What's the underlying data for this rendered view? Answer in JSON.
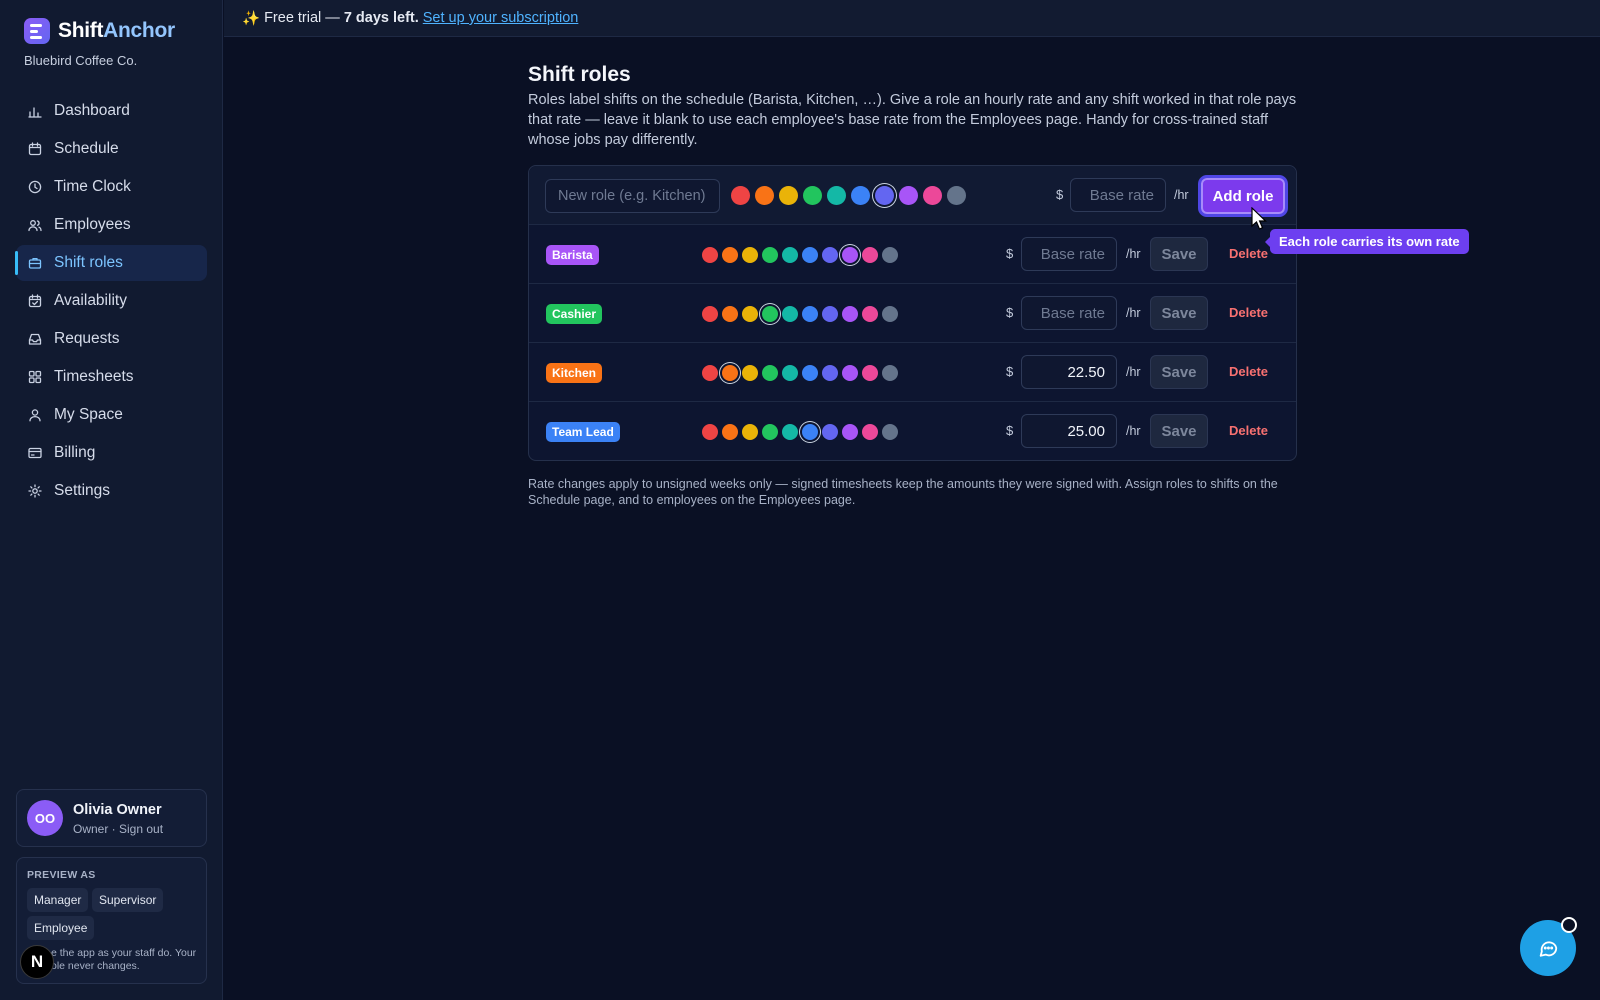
{
  "brand": {
    "name_part1": "Shift",
    "name_part2": "Anchor",
    "org": "Bluebird Coffee Co."
  },
  "nav": [
    {
      "label": "Dashboard",
      "icon": "bar-chart-icon",
      "active": false
    },
    {
      "label": "Schedule",
      "icon": "calendar-icon",
      "active": false
    },
    {
      "label": "Time Clock",
      "icon": "clock-icon",
      "active": false
    },
    {
      "label": "Employees",
      "icon": "users-icon",
      "active": false
    },
    {
      "label": "Shift roles",
      "icon": "briefcase-icon",
      "active": true
    },
    {
      "label": "Availability",
      "icon": "calendar-check-icon",
      "active": false
    },
    {
      "label": "Requests",
      "icon": "inbox-icon",
      "active": false
    },
    {
      "label": "Timesheets",
      "icon": "grid-icon",
      "active": false
    },
    {
      "label": "My Space",
      "icon": "user-icon",
      "active": false
    },
    {
      "label": "Billing",
      "icon": "credit-card-icon",
      "active": false
    },
    {
      "label": "Settings",
      "icon": "gear-icon",
      "active": false
    }
  ],
  "user": {
    "initials": "OO",
    "name": "Olivia Owner",
    "role_line": "Owner · Sign out"
  },
  "preview": {
    "title": "PREVIEW AS",
    "chips": [
      "Manager",
      "Supervisor",
      "Employee"
    ],
    "note": "e the app as your staff do. Your ole never changes."
  },
  "banner": {
    "prefix": "Free trial —",
    "strong": "7 days left.",
    "link": "Set up your subscription"
  },
  "page": {
    "title": "Shift roles",
    "description": "Roles label shifts on the schedule (Barista, Kitchen, …). Give a role an hourly rate and any shift worked in that role pays that rate — leave it blank to use each employee's base rate from the Employees page. Handy for cross-trained staff whose jobs pay differently.",
    "footnote": "Rate changes apply to unsigned weeks only — signed timesheets keep the amounts they were signed with. Assign roles to shifts on the Schedule page, and to employees on the Employees page."
  },
  "palette": [
    "#ef4444",
    "#f97316",
    "#eab308",
    "#22c55e",
    "#14b8a6",
    "#3b82f6",
    "#6366f1",
    "#a855f7",
    "#ec4899",
    "#64748b"
  ],
  "new_role": {
    "placeholder": "New role (e.g. Kitchen)",
    "selected_color_index": 6,
    "currency": "$",
    "rate_placeholder": "Base rate",
    "unit": "/hr",
    "add_label": "Add role"
  },
  "roles": [
    {
      "name": "Barista",
      "color": "#a855f7",
      "selected_color_index": 7,
      "rate": "",
      "rate_placeholder": "Base rate"
    },
    {
      "name": "Cashier",
      "color": "#22c55e",
      "selected_color_index": 3,
      "rate": "",
      "rate_placeholder": "Base rate"
    },
    {
      "name": "Kitchen",
      "color": "#f97316",
      "selected_color_index": 1,
      "rate": "22.50",
      "rate_placeholder": "Base rate"
    },
    {
      "name": "Team Lead",
      "color": "#3b82f6",
      "selected_color_index": 5,
      "rate": "25.00",
      "rate_placeholder": "Base rate"
    }
  ],
  "row_actions": {
    "currency": "$",
    "unit": "/hr",
    "save_label": "Save",
    "delete_label": "Delete"
  },
  "tooltip": "Each role carries its own rate",
  "floating": {
    "n_badge": "N"
  }
}
